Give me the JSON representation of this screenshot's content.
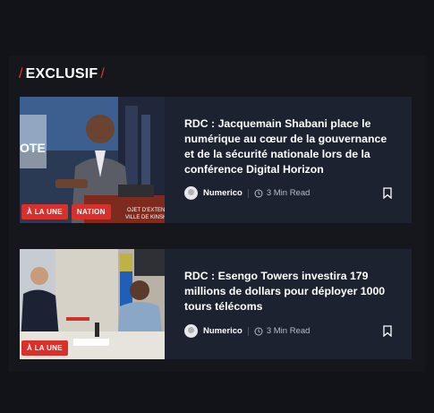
{
  "section": {
    "title": "EXCLUSIF"
  },
  "articles": [
    {
      "title": "RDC : Jacquemain Shabani place le numérique au cœur de la gouvernance et de la sécurité nationale lors de la conférence Digital Horizon",
      "badges": [
        "À LA UNE",
        "NATION"
      ],
      "author": "Numerico",
      "read_time": "3 Min Read"
    },
    {
      "title": "RDC : Esengo Towers investira 179 millions de dollars pour déployer 1000 tours télécoms",
      "badges": [
        "À LA UNE"
      ],
      "author": "Numerico",
      "read_time": "3 Min Read"
    }
  ],
  "colors": {
    "accent": "#d9302b",
    "card_bg": "#1d2230",
    "page_bg": "#111319"
  }
}
